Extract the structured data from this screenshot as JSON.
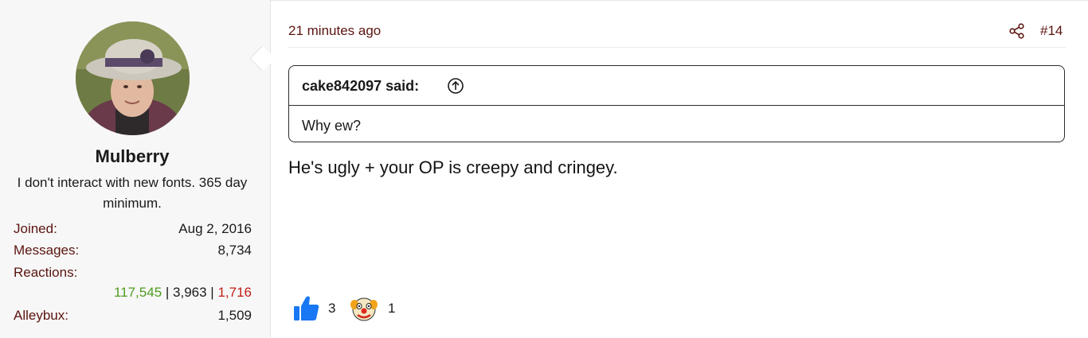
{
  "user": {
    "name": "Mulberry",
    "title": "I don't interact with new fonts. 365 day minimum.",
    "stats": {
      "joined_label": "Joined:",
      "joined_value": "Aug 2, 2016",
      "messages_label": "Messages:",
      "messages_value": "8,734",
      "reactions_label": "Reactions:",
      "reactions_positive": "117,545",
      "reactions_neutral": "3,963",
      "reactions_negative": "1,716",
      "separator": " | ",
      "alleybux_label": "Alleybux:",
      "alleybux_value": "1,509"
    }
  },
  "post": {
    "timestamp": "21 minutes ago",
    "number": "#14",
    "quote": {
      "author": "cake842097 said:",
      "text": "Why ew?"
    },
    "body": "He's ugly + your OP is creepy and cringey.",
    "reactions": [
      {
        "icon": "thumbs-up-icon",
        "count": "3"
      },
      {
        "icon": "clown-face-icon",
        "count": "1"
      }
    ]
  },
  "colors": {
    "link": "#5a1410",
    "positive": "#4f9d1f",
    "negative": "#c21d16",
    "like": "#1877f2"
  }
}
